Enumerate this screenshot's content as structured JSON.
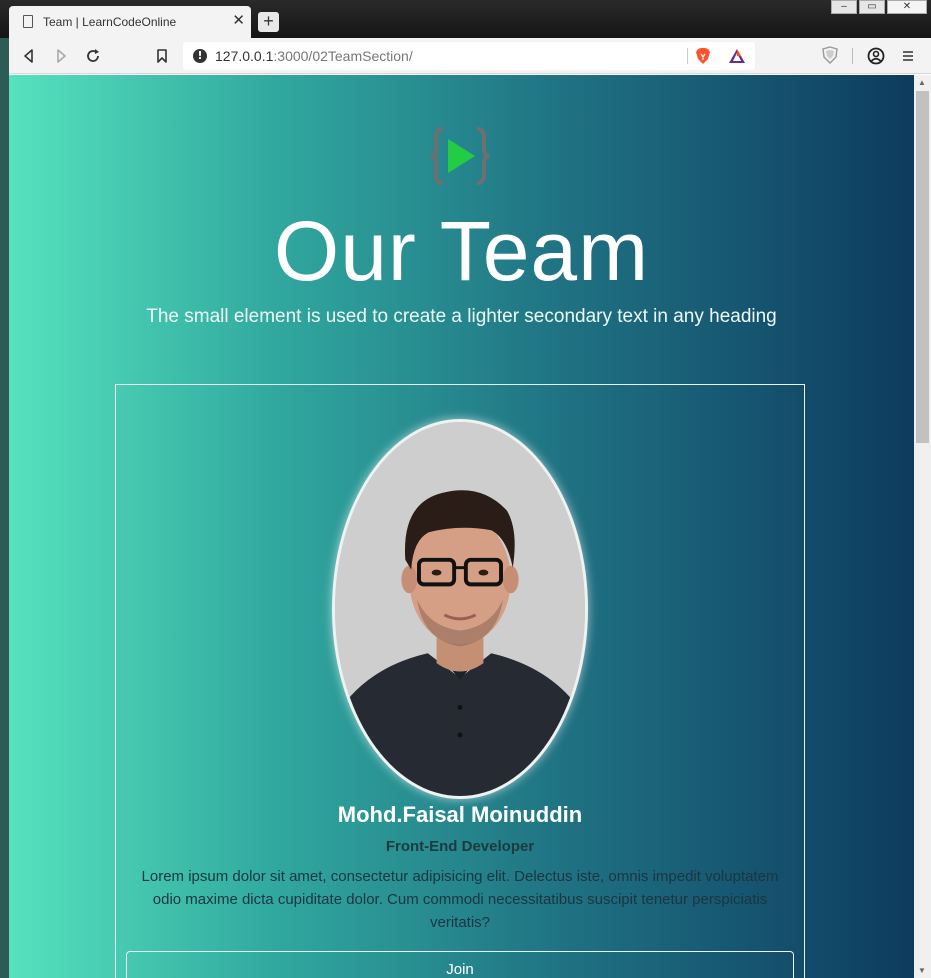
{
  "browser": {
    "tab_title": "Team | LearnCodeOnline",
    "tab_close": "✕",
    "new_tab": "+",
    "url_host": "127.0.0.1",
    "url_rest": ":3000/02TeamSection/",
    "window_controls": [
      "–",
      "▭",
      "✕"
    ]
  },
  "page": {
    "title": "Our Team",
    "subtitle": "The small element is used to create a lighter secondary text in any heading",
    "member": {
      "name": "Mohd.Faisal Moinuddin",
      "role": "Front-End Developer",
      "bio": "Lorem ipsum dolor sit amet, consectetur adipisicing elit. Delectus iste, omnis impedit voluptatem odio maxime dicta cupiditate dolor. Cum commodi necessitatibus suscipit tenetur perspiciatis veritatis?",
      "button": "Join"
    }
  },
  "colors": {
    "gradient_start": "#56e2be",
    "gradient_end": "#0d3b5f",
    "logo_play": "#22cc44",
    "logo_brace": "#6f6f6f"
  },
  "icons": [
    "document-icon",
    "back-icon",
    "forward-icon",
    "reload-icon",
    "bookmark-icon",
    "info-icon",
    "brave-lion-icon",
    "brave-rewards-icon",
    "shield-icon",
    "account-icon",
    "menu-icon",
    "logo-play-icon"
  ]
}
